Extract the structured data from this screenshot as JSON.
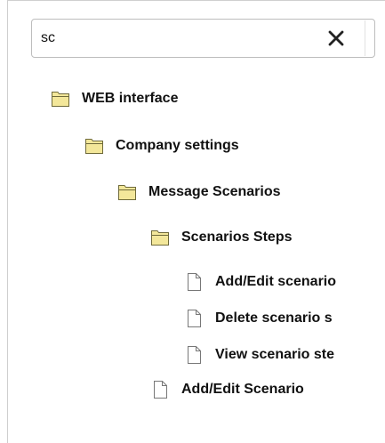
{
  "search": {
    "value": "sc",
    "clear_icon": "close-icon"
  },
  "tree": {
    "items": [
      {
        "label": "WEB interface",
        "icon": "folder-icon",
        "level": 0
      },
      {
        "label": "Company settings",
        "icon": "folder-icon",
        "level": 1
      },
      {
        "label": "Message Scenarios",
        "icon": "folder-icon",
        "level": 2
      },
      {
        "label": "Scenarios Steps",
        "icon": "folder-icon",
        "level": 3
      },
      {
        "label": "Add/Edit scenario",
        "icon": "document-icon",
        "level": 4
      },
      {
        "label": "Delete scenario s",
        "icon": "document-icon",
        "level": 4
      },
      {
        "label": "View scenario ste",
        "icon": "document-icon",
        "level": 4
      },
      {
        "label": "Add/Edit Scenario",
        "icon": "document-icon",
        "level": 3
      }
    ]
  },
  "colors": {
    "folder_fill": "#f3e79a",
    "folder_stroke": "#6f6a3a",
    "document_fill": "#ffffff",
    "document_stroke": "#777777"
  }
}
